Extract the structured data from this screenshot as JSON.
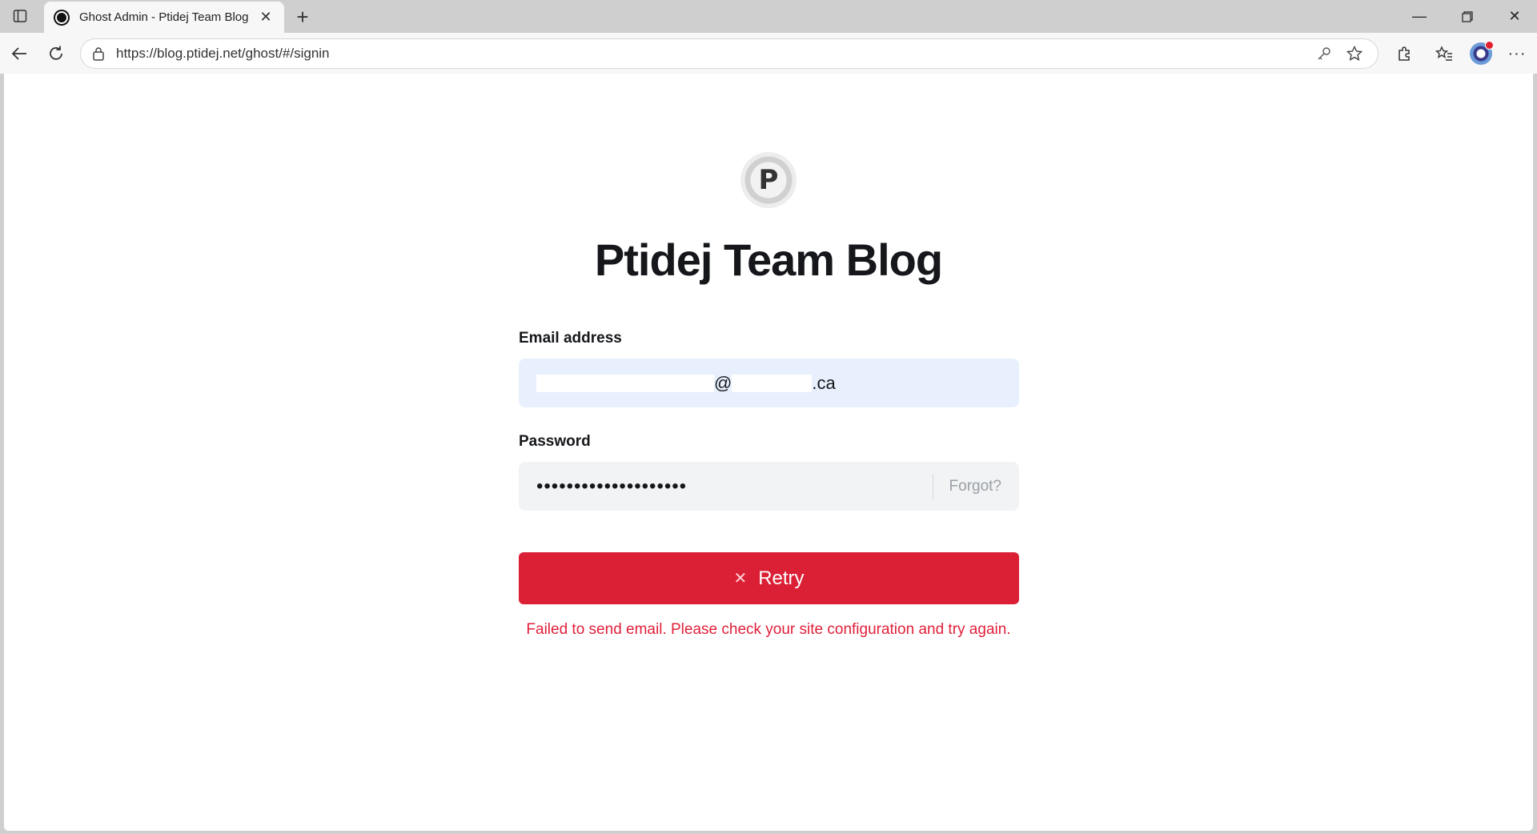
{
  "browser": {
    "tab_title": "Ghost Admin - Ptidej Team Blog",
    "url": "https://blog.ptidej.net/ghost/#/signin"
  },
  "site": {
    "logo_letter": "P",
    "title": "Ptidej Team Blog"
  },
  "form": {
    "email_label": "Email address",
    "email_domain_suffix": ".ca",
    "email_at": "@",
    "password_label": "Password",
    "password_masked": "••••••••••••••••••••",
    "forgot_label": "Forgot?",
    "retry_label": "Retry",
    "error_message": "Failed to send email. Please check your site configuration and try again."
  },
  "colors": {
    "retry_button": "#db2036",
    "error_text": "#e0203a",
    "email_autofill_bg": "#e8f0fe"
  }
}
